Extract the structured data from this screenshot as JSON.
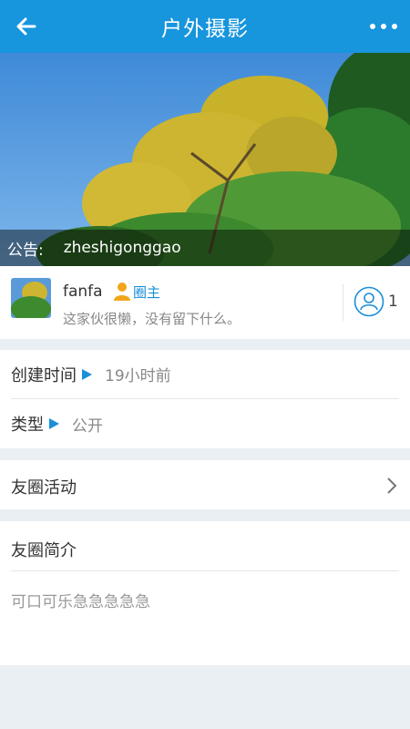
{
  "header": {
    "title": "户外摄影",
    "back_icon": "arrow-left-icon",
    "more_icon": "more-dots-icon",
    "bg_color": "#1795dd"
  },
  "banner": {
    "notice_label": "公告:",
    "notice_text": "zheshigonggao"
  },
  "owner": {
    "name": "fanfa",
    "role": "圈主",
    "bio": "这家伙很懒，没有留下什么。",
    "member_count": "1",
    "member_icon": "user-outline-icon",
    "role_icon": "person-icon"
  },
  "info": {
    "created_label": "创建时间",
    "created_value": "19小时前",
    "type_label": "类型",
    "type_value": "公开"
  },
  "activity": {
    "label": "友圈活动"
  },
  "intro": {
    "label": "友圈简介",
    "text": "可口可乐急急急急急"
  }
}
